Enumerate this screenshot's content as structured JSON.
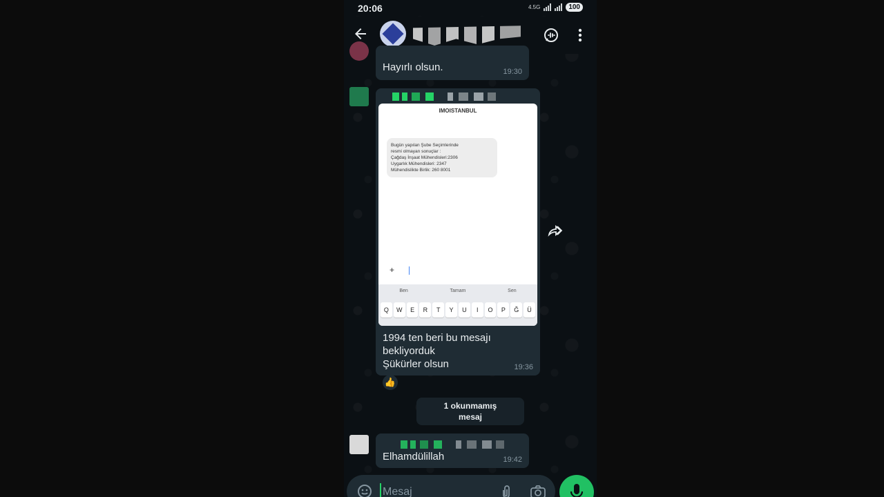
{
  "status_bar": {
    "time": "20:06",
    "network_label": "4.5G",
    "battery": "100"
  },
  "header": {
    "contact_name": ""
  },
  "messages": [
    {
      "id": "msg1",
      "text": "Hayırlı olsun.",
      "time": "19:30"
    },
    {
      "id": "msg2",
      "screenshot": {
        "sender": "IMOISTANBUL",
        "sms_text": "Bugün yapılan Şube Seçimlerinde\nresmi olmayan sonuçlar :\nÇağdaş İnşaat Mühendisleri:2306\nUygarlık Mühendisleri: 2347\nMühendislikte Birlik: 260 8001",
        "compose_plus": "+",
        "keyboard_suggestions": [
          "Ben",
          "Tamam",
          "Sen"
        ],
        "keyboard_keys": [
          "Q",
          "W",
          "E",
          "R",
          "T",
          "Y",
          "U",
          "I",
          "O",
          "P",
          "Ğ",
          "Ü"
        ]
      },
      "text": "1994 ten beri bu mesajı\nbekliyorduk\nŞükürler olsun",
      "time": "19:36",
      "reaction": "👍"
    },
    {
      "id": "msg3",
      "text": "Elhamdülillah",
      "time": "19:42"
    }
  ],
  "unread_divider": {
    "line1": "1 okunmamış",
    "line2": "mesaj"
  },
  "composer": {
    "placeholder": "Mesaj"
  },
  "colors": {
    "accent": "#25d366",
    "bubble_incoming": "#1f2c34",
    "background": "#0b1014",
    "mic_button": "#21c063"
  },
  "icons": [
    "back-arrow-icon",
    "voice-call-icon",
    "more-options-icon",
    "forward-icon",
    "emoji-icon",
    "attach-icon",
    "camera-icon",
    "mic-icon"
  ]
}
